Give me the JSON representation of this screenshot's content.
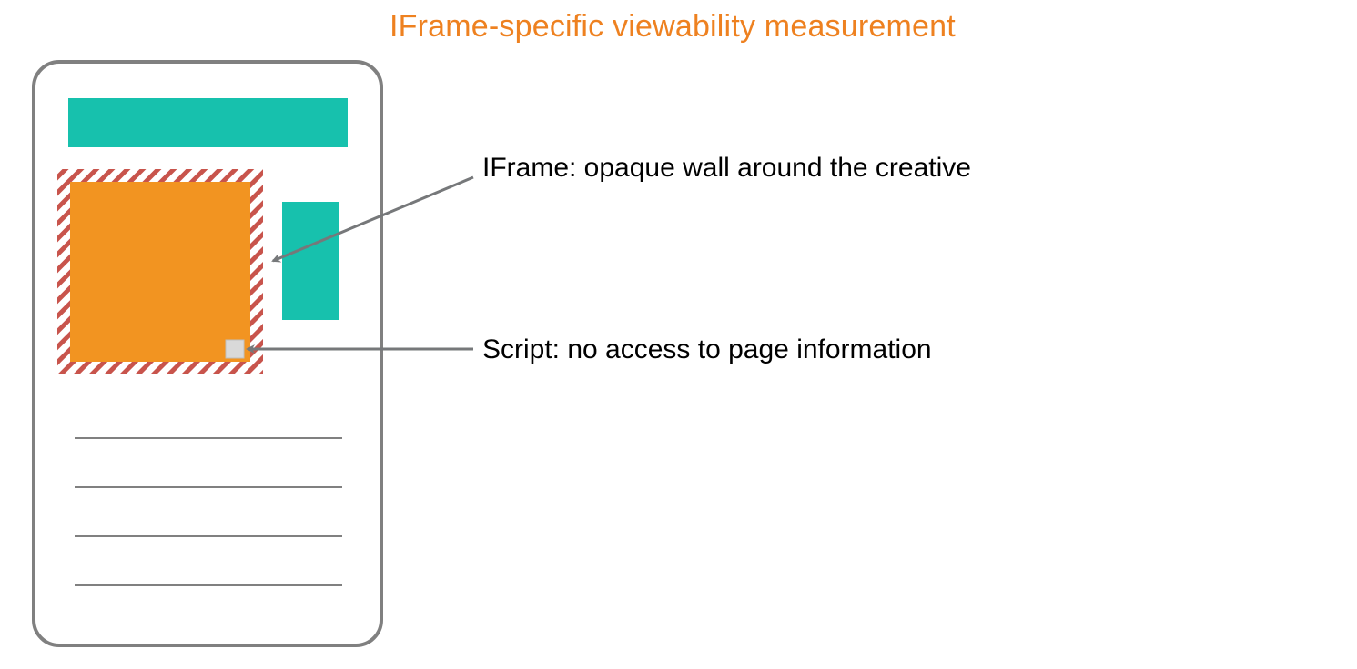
{
  "title": "IFrame-specific viewability measurement",
  "callouts": {
    "iframe": "IFrame: opaque wall around the creative",
    "script": "Script: no access to page information"
  },
  "colors": {
    "accent_orange": "#ee8120",
    "creative_orange": "#f29421",
    "teal": "#17c1ad",
    "hatch_red": "#c8544c",
    "frame_gray": "#808080",
    "line_gray": "#808080",
    "script_fill": "#d9d9d9",
    "arrow_gray": "#76787a"
  }
}
